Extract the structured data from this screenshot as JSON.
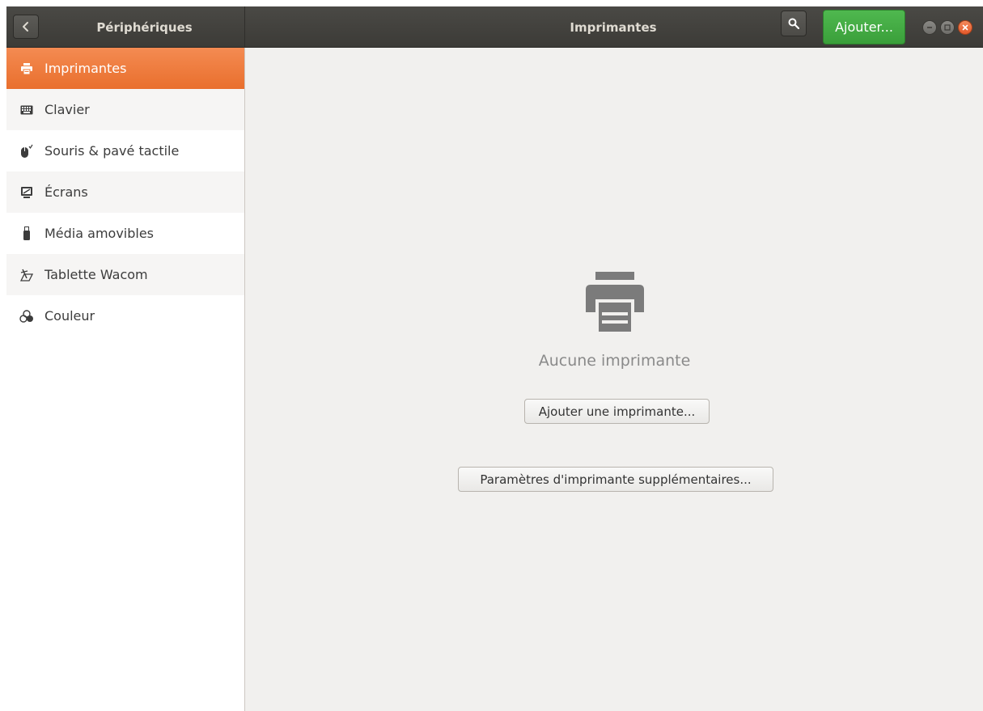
{
  "header": {
    "left_title": "Périphériques",
    "title": "Imprimantes",
    "add_label": "Ajouter...",
    "icons": {
      "back": "chevron-left-icon",
      "search": "search-icon"
    }
  },
  "window_controls": [
    "minimize",
    "maximize",
    "close"
  ],
  "sidebar": {
    "items": [
      {
        "label": "Imprimantes",
        "icon": "printer-icon",
        "active": true
      },
      {
        "label": "Clavier",
        "icon": "keyboard-icon"
      },
      {
        "label": "Souris & pavé tactile",
        "icon": "mouse-icon"
      },
      {
        "label": "Écrans",
        "icon": "display-icon"
      },
      {
        "label": "Média amovibles",
        "icon": "usb-drive-icon"
      },
      {
        "label": "Tablette Wacom",
        "icon": "tablet-pen-icon"
      },
      {
        "label": "Couleur",
        "icon": "color-icon"
      }
    ]
  },
  "main": {
    "empty_icon": "printer-icon",
    "empty_label": "Aucune imprimante",
    "add_printer_label": "Ajouter une imprimante...",
    "more_settings_label": "Paramètres d'imprimante supplémentaires..."
  },
  "colors": {
    "header_bg": "#3c3b37",
    "active_item": "#e96f2d",
    "add_button": "#3a9f3a",
    "close_button": "#e2582a"
  }
}
